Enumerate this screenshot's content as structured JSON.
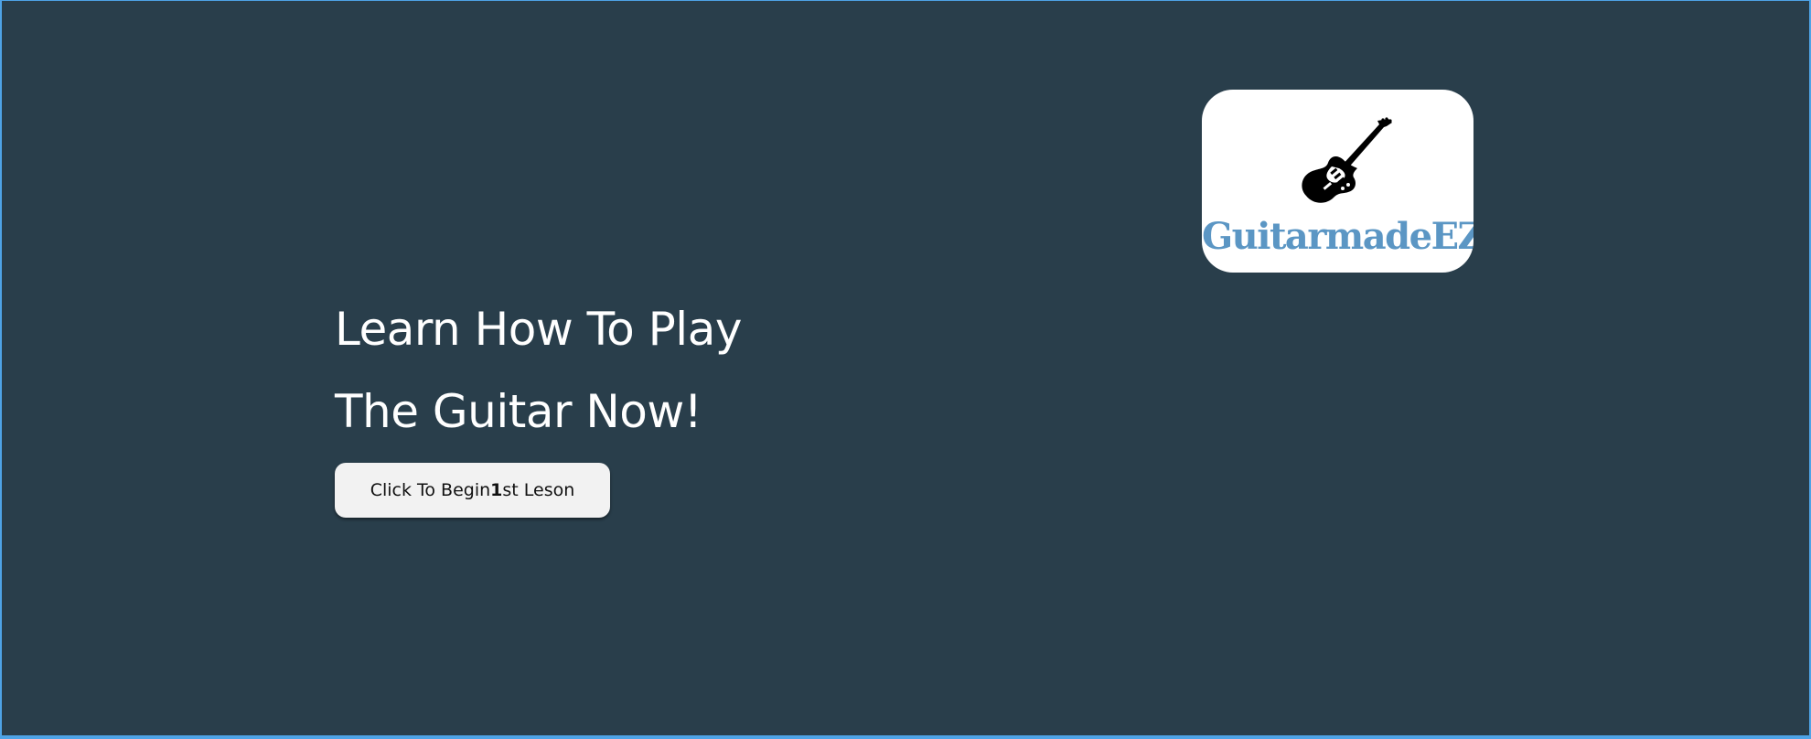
{
  "hero": {
    "line1": "Learn How To Play",
    "line2": "The Guitar Now!"
  },
  "cta": {
    "prefix": "Click To Begin ",
    "bold": "1",
    "suffix": "st Leson"
  },
  "logo": {
    "text": "GuitarmadeEZ",
    "icon": "electric-guitar-icon"
  },
  "colors": {
    "background": "#293e4b",
    "accent_border": "#4ea3e6",
    "logo_text": "#5b96c4",
    "button_bg": "#f2f2f2"
  }
}
